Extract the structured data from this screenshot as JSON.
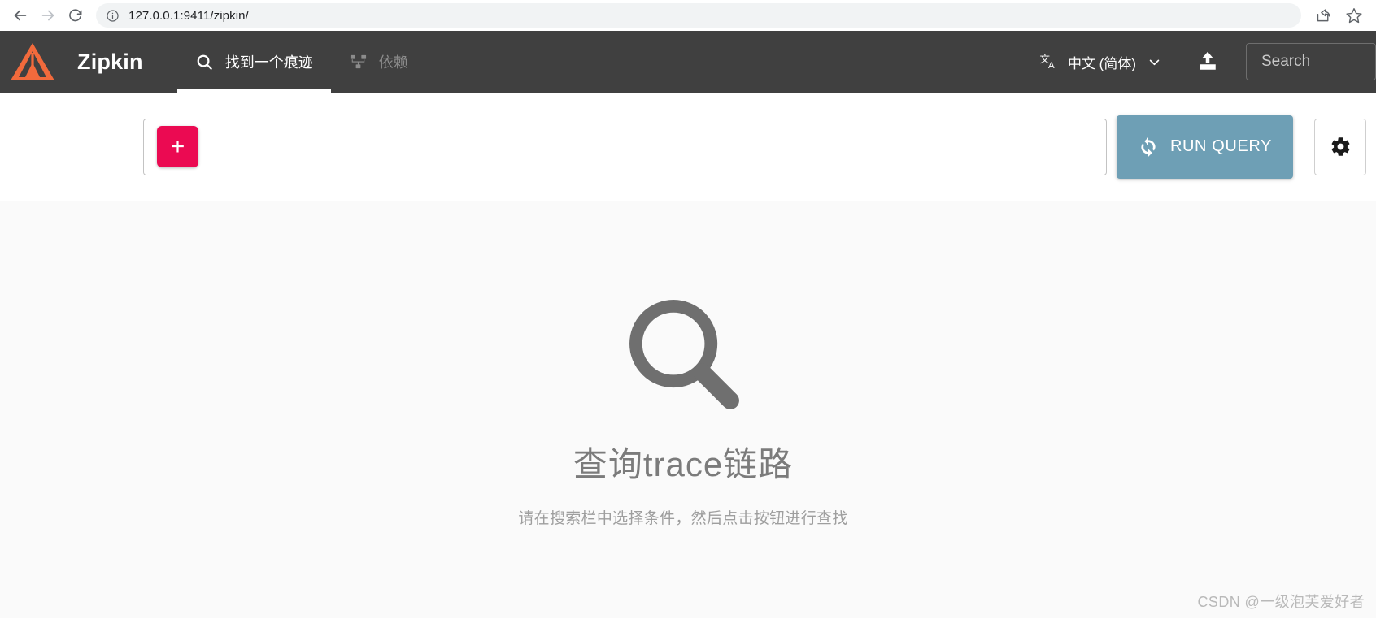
{
  "browser": {
    "back_label": "back-arrow",
    "forward_label": "forward-arrow",
    "reload_label": "reload",
    "site_info_label": "site-information",
    "url_prefix": "127.0.0.1:",
    "url_suffix": "9411/zipkin/",
    "url_full": "127.0.0.1:9411/zipkin/",
    "share_label": "share",
    "bookmark_label": "bookmark-star"
  },
  "header": {
    "brand": "Zipkin",
    "logo_color": "#f26a3c",
    "background": "#404040",
    "tabs": [
      {
        "label": "找到一个痕迹",
        "icon": "search-icon",
        "active": true
      },
      {
        "label": "依赖",
        "icon": "account-tree-icon",
        "active": false
      }
    ],
    "language": {
      "icon": "translate-icon",
      "value": "中文 (简体)",
      "chevron": "chevron-down-icon"
    },
    "upload": {
      "icon": "upload-icon"
    },
    "search": {
      "placeholder": "Search",
      "value": "Search"
    }
  },
  "toolbar": {
    "add_criterion_label": "+",
    "add_criterion_color": "#eb0a52",
    "run_query_label": "RUN QUERY",
    "run_query_color": "#6e9fb5",
    "run_query_icon": "sync-icon",
    "settings_icon": "gear-icon",
    "query_placeholder": ""
  },
  "main": {
    "empty_icon": "magnifier-icon",
    "empty_icon_color": "#6f6f6f",
    "title": "查询trace链路",
    "subtitle": "请在搜索栏中选择条件，然后点击按钮进行查找",
    "watermark": "CSDN @一级泡芙爱好者"
  }
}
